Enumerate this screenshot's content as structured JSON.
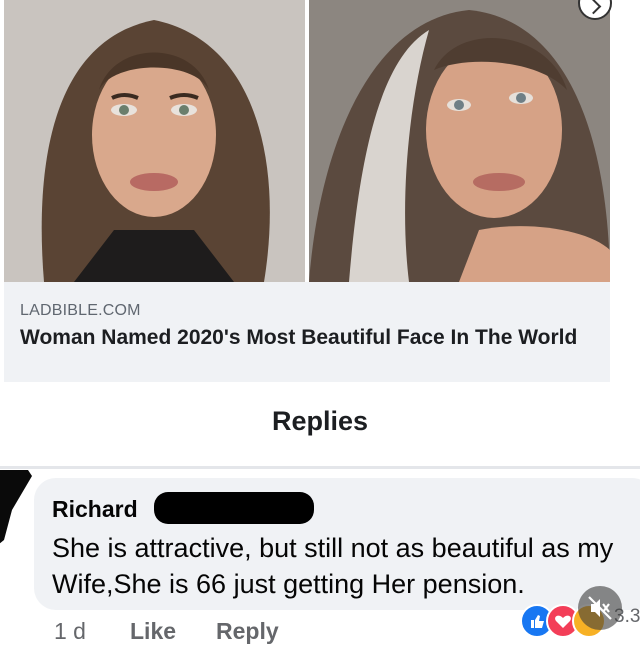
{
  "link_preview": {
    "source": "LADBIBLE.COM",
    "headline": "Woman Named 2020's Most Beautiful Face In The World"
  },
  "replies": {
    "title": "Replies"
  },
  "comment": {
    "author": "Richard",
    "text": "She is attractive, but still not as beautiful as my Wife,She is 66 just getting Her pension.",
    "time": "1 d",
    "like_label": "Like",
    "reply_label": "Reply",
    "reaction_count": "3.3",
    "reactions": [
      "like-reaction-icon",
      "love-reaction-icon",
      "haha-reaction-icon"
    ]
  },
  "colors": {
    "card_background": "#f0f2f5",
    "bubble_background": "#f0f2f5",
    "like_blue": "#1877f2",
    "love_red": "#f33e58",
    "haha_yellow": "#f7b125",
    "meta_text": "#65676b"
  }
}
